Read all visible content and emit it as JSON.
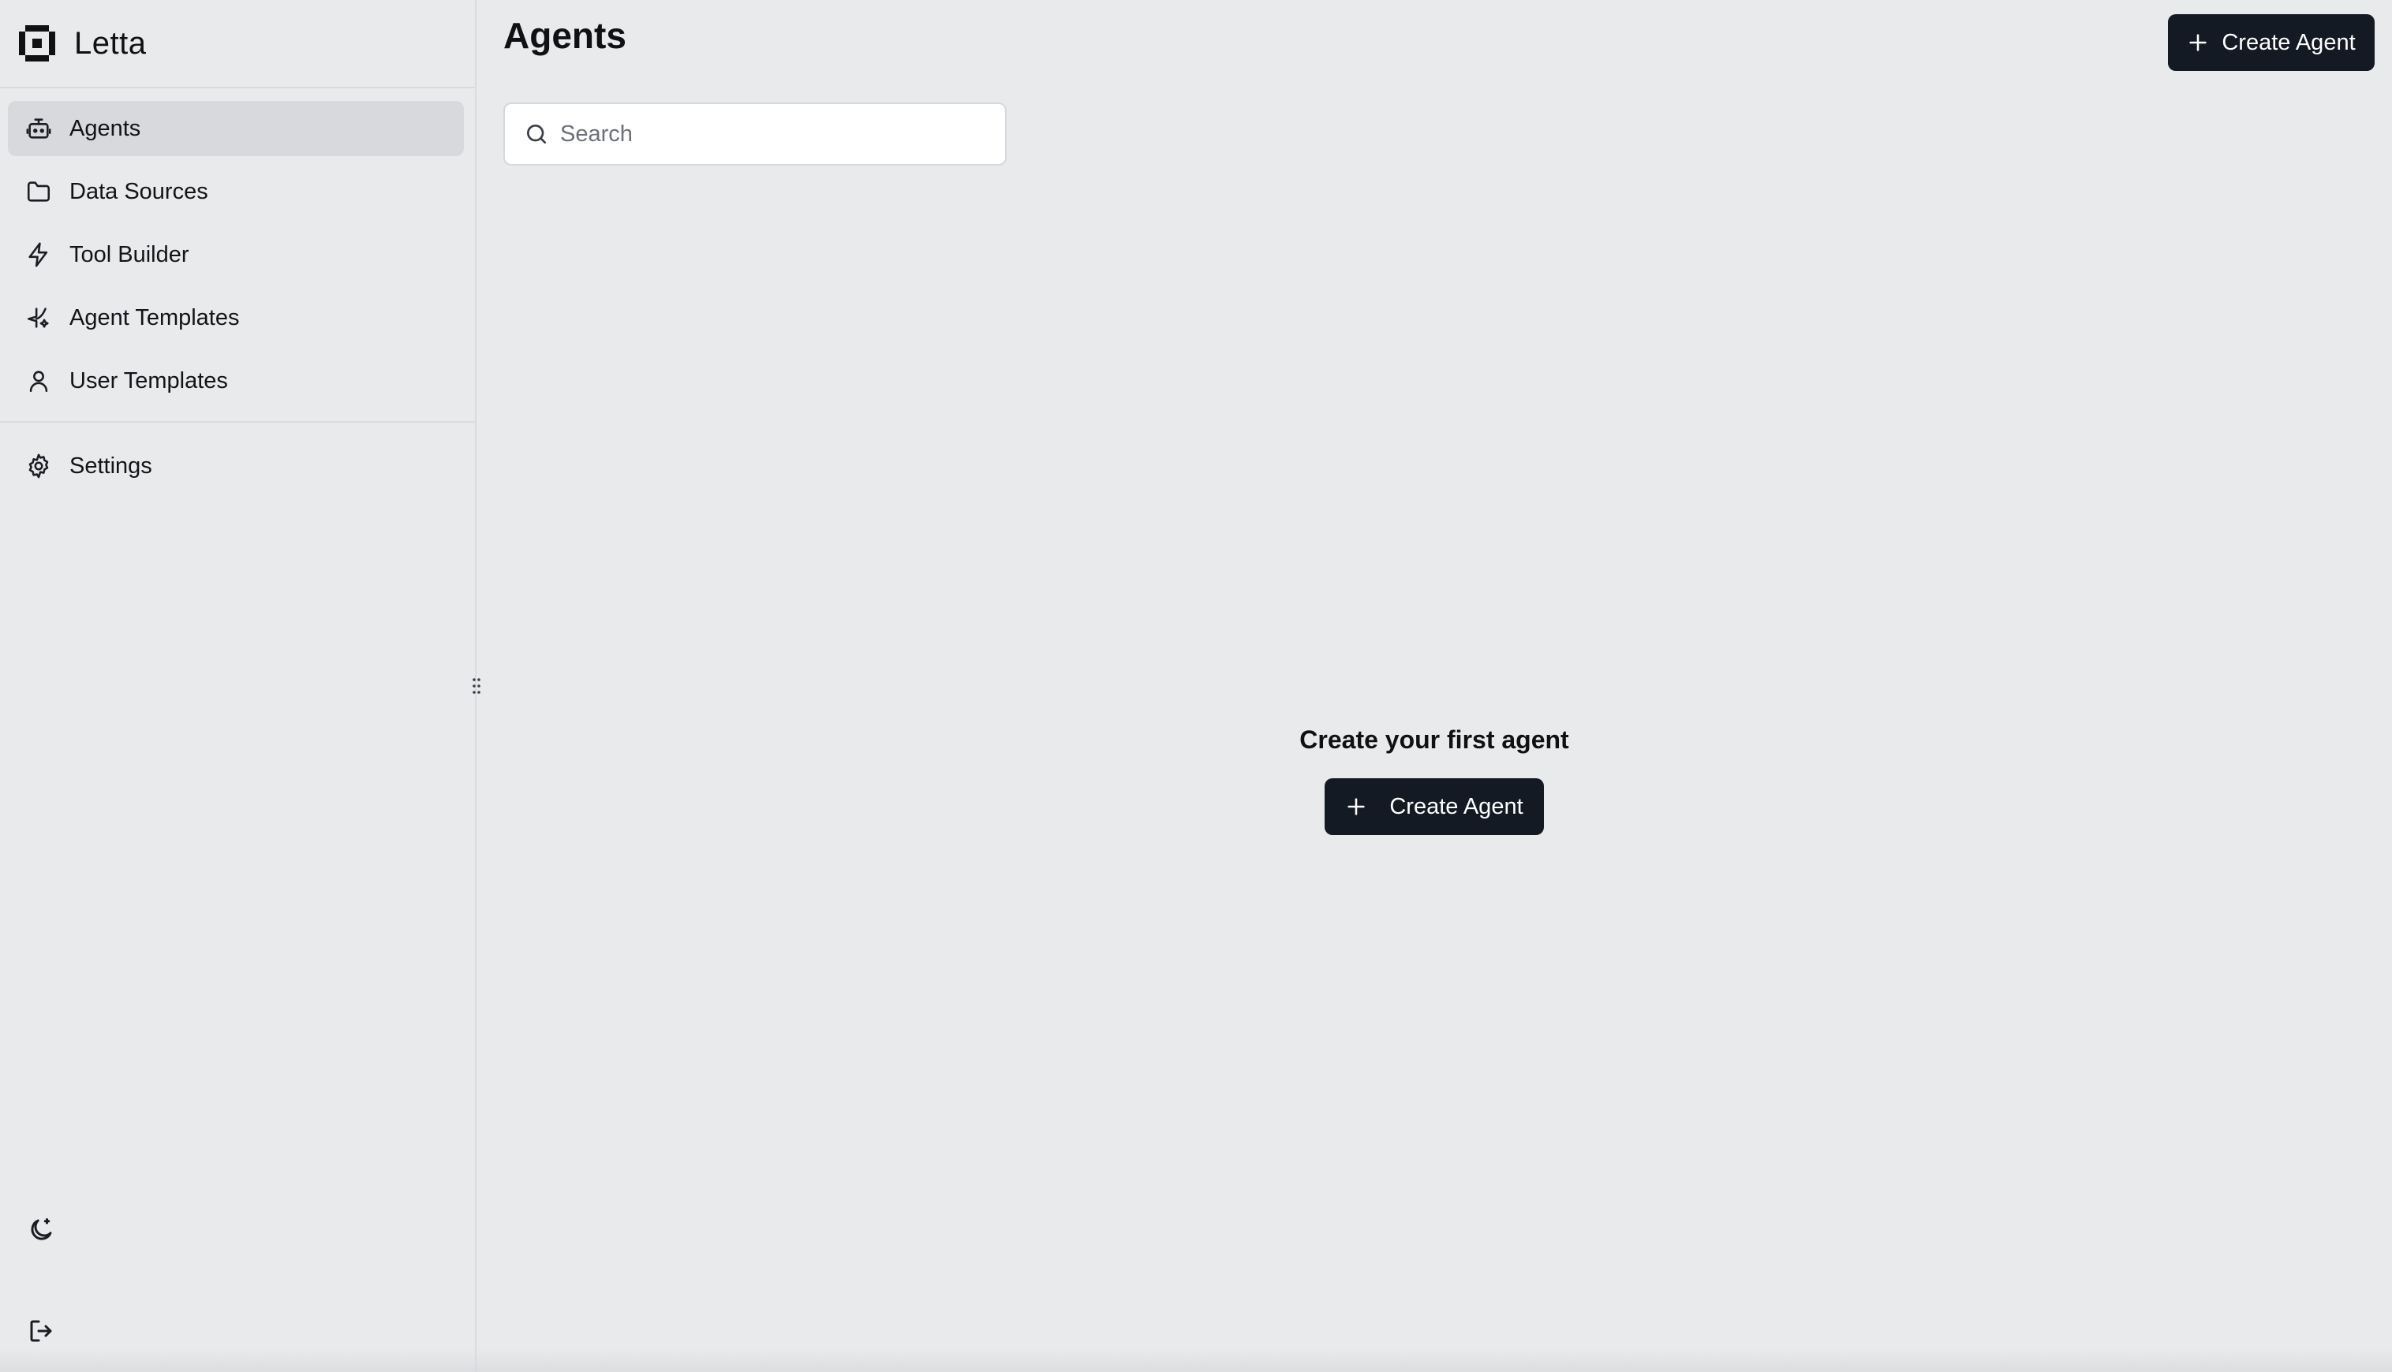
{
  "brand": {
    "name": "Letta",
    "logo_icon": "letta-logo-icon"
  },
  "sidebar": {
    "items": [
      {
        "label": "Agents",
        "icon": "robot-icon",
        "active": true
      },
      {
        "label": "Data Sources",
        "icon": "folder-icon",
        "active": false
      },
      {
        "label": "Tool Builder",
        "icon": "lightning-icon",
        "active": false
      },
      {
        "label": "Agent Templates",
        "icon": "sparkle-icon",
        "active": false
      },
      {
        "label": "User Templates",
        "icon": "user-icon",
        "active": false
      }
    ],
    "settings": {
      "label": "Settings",
      "icon": "gear-icon"
    },
    "bottom_icons": [
      "moon-icon",
      "logout-icon"
    ]
  },
  "header": {
    "title": "Agents",
    "create_button_label": "Create Agent"
  },
  "search": {
    "placeholder": "Search",
    "value": ""
  },
  "empty_state": {
    "title": "Create your first agent",
    "button_label": "Create Agent"
  },
  "colors": {
    "background": "#e9eaec",
    "active_nav": "#d8d9dc",
    "primary_button": "#141a24",
    "primary_button_text": "#ffffff"
  }
}
